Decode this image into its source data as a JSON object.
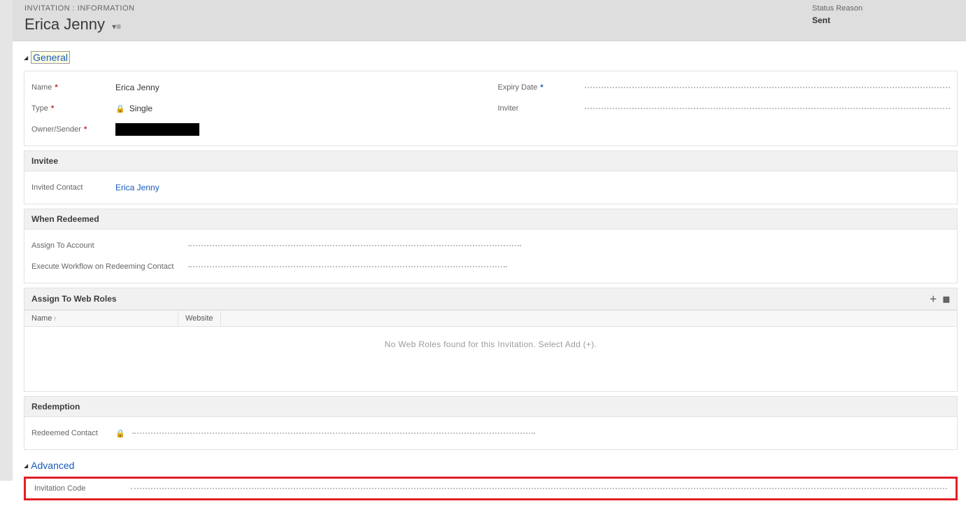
{
  "header": {
    "form_type": "INVITATION : INFORMATION",
    "record_title": "Erica Jenny",
    "status_label": "Status Reason",
    "status_value": "Sent"
  },
  "tabs": {
    "general": "General",
    "advanced": "Advanced"
  },
  "general": {
    "fields": {
      "name_label": "Name",
      "name_value": "Erica Jenny",
      "type_label": "Type",
      "type_value": "Single",
      "owner_label": "Owner/Sender",
      "expiry_label": "Expiry Date",
      "inviter_label": "Inviter"
    },
    "invitee": {
      "header": "Invitee",
      "invited_contact_label": "Invited Contact",
      "invited_contact_value": "Erica Jenny"
    },
    "when_redeemed": {
      "header": "When Redeemed",
      "assign_account_label": "Assign To Account",
      "exec_workflow_label": "Execute Workflow on Redeeming Contact"
    },
    "web_roles": {
      "header": "Assign To Web Roles",
      "col_name": "Name",
      "col_website": "Website",
      "empty_text": "No Web Roles found for this Invitation. Select Add (+)."
    },
    "redemption": {
      "header": "Redemption",
      "redeemed_contact_label": "Redeemed Contact"
    }
  },
  "advanced": {
    "invitation_code_label": "Invitation Code"
  }
}
